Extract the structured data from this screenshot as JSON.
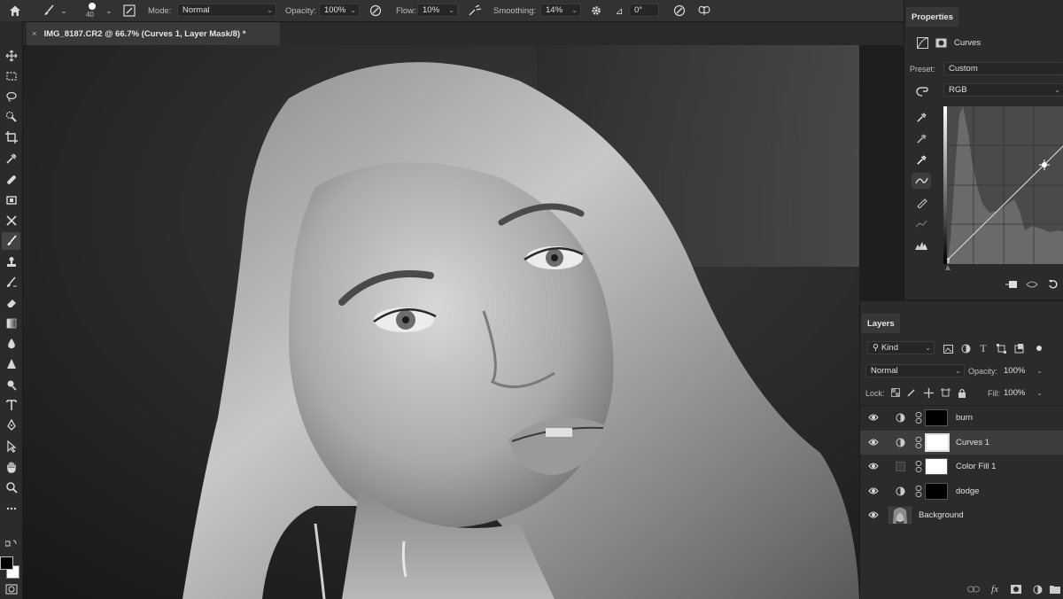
{
  "options_bar": {
    "brush_size": "40",
    "mode_label": "Mode:",
    "mode_value": "Normal",
    "opacity_label": "Opacity:",
    "opacity_value": "100%",
    "flow_label": "Flow:",
    "flow_value": "10%",
    "smoothing_label": "Smoothing:",
    "smoothing_value": "14%",
    "angle_value": "0°"
  },
  "document_tab": {
    "close": "×",
    "title": "IMG_8187.CR2 @ 66.7% (Curves 1, Layer Mask/8) *"
  },
  "properties": {
    "tab": "Properties",
    "adjustment_name": "Curves",
    "preset_label": "Preset:",
    "preset_value": "Custom",
    "channel_value": "RGB"
  },
  "layers": {
    "tab": "Layers",
    "kind_value": "Kind",
    "blend_mode": "Normal",
    "opacity_label": "Opacity:",
    "opacity_value": "100%",
    "lock_label": "Lock:",
    "fill_label": "Fill:",
    "fill_value": "100%",
    "items": [
      {
        "name": "burn",
        "selected": false
      },
      {
        "name": "Curves 1",
        "selected": true
      },
      {
        "name": "Color Fill 1",
        "selected": false
      },
      {
        "name": "dodge",
        "selected": false
      },
      {
        "name": "Background",
        "selected": false
      }
    ]
  },
  "colors": {
    "panel_bg": "#2b2b2b",
    "optbar_bg": "#323232",
    "selected_row": "#3d3d3d",
    "foreground_swatch": "#000000",
    "background_swatch": "#ffffff"
  },
  "icons": [
    "home-icon",
    "brush-icon",
    "move-icon",
    "marquee-icon",
    "lasso-icon",
    "quick-select-icon",
    "crop-icon",
    "eyedropper-icon",
    "healing-icon",
    "brush-icon",
    "stamp-icon",
    "history-brush-icon",
    "eraser-icon",
    "gradient-icon",
    "blur-icon",
    "dodge-icon",
    "pen-icon",
    "type-icon",
    "path-select-icon",
    "shape-icon",
    "hand-icon",
    "zoom-icon",
    "eye-icon",
    "link-icon",
    "curves-icon"
  ]
}
